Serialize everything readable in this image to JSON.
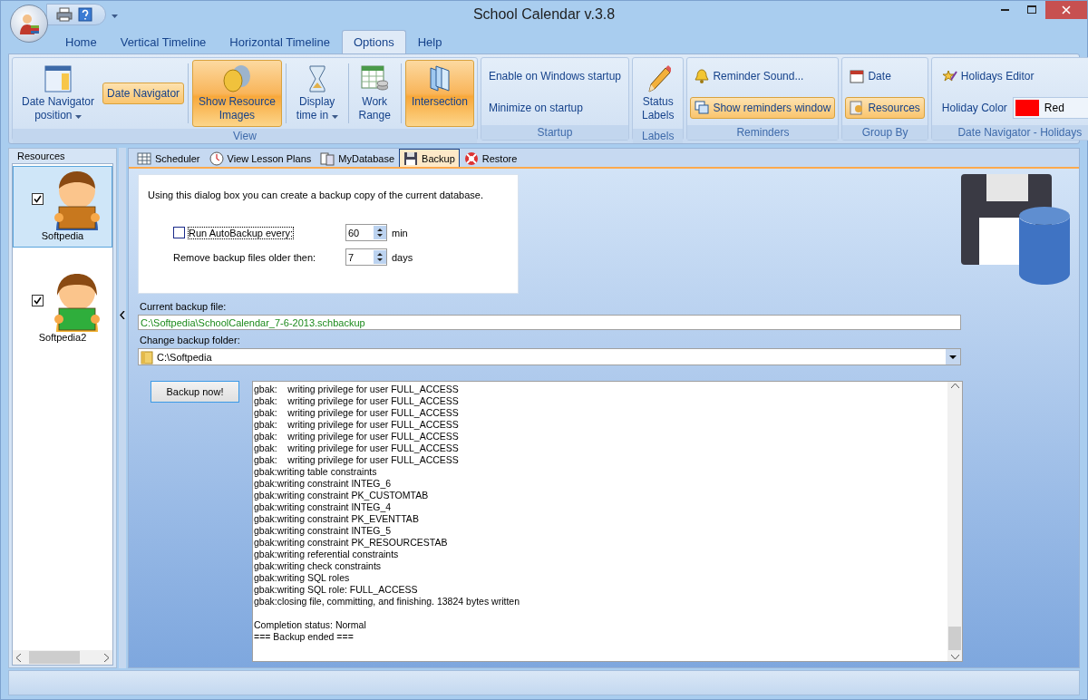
{
  "window": {
    "title": "School Calendar v.3.8"
  },
  "menu_tabs": [
    {
      "label": "Home",
      "selected": false
    },
    {
      "label": "Vertical Timeline",
      "selected": false
    },
    {
      "label": "Horizontal Timeline",
      "selected": false
    },
    {
      "label": "Options",
      "selected": true
    },
    {
      "label": "Help",
      "selected": false
    }
  ],
  "ribbon": {
    "groups": [
      {
        "label": "View",
        "items": [
          {
            "kind": "large",
            "lines": [
              "Date Navigator",
              "position"
            ],
            "dropdown": true,
            "selected": false
          },
          {
            "kind": "small",
            "label": "Date Navigator",
            "selected": true
          },
          {
            "kind": "large",
            "lines": [
              "Show Resource",
              "Images"
            ],
            "dropdown": false,
            "selected": true
          },
          {
            "kind": "large",
            "lines": [
              "Display",
              "time in"
            ],
            "dropdown": true,
            "selected": false
          },
          {
            "kind": "large",
            "lines": [
              "Work",
              "Range"
            ],
            "dropdown": false,
            "selected": false
          },
          {
            "kind": "large",
            "lines": [
              "Intersection"
            ],
            "dropdown": false,
            "selected": true
          }
        ]
      },
      {
        "label": "Startup",
        "items": [
          {
            "kind": "stack",
            "buttons": [
              {
                "label": "Enable on Windows startup",
                "selected": false
              },
              {
                "label": "Minimize on startup",
                "selected": false
              }
            ]
          }
        ]
      },
      {
        "label": "Labels",
        "items": [
          {
            "kind": "large",
            "lines": [
              "Status",
              "Labels"
            ],
            "dropdown": false,
            "selected": false
          }
        ]
      },
      {
        "label": "Reminders",
        "items": [
          {
            "kind": "stack",
            "buttons": [
              {
                "label": "Reminder Sound...",
                "selected": false
              },
              {
                "label": "Show reminders window",
                "selected": true
              }
            ]
          }
        ]
      },
      {
        "label": "Group By",
        "items": [
          {
            "kind": "stack",
            "buttons": [
              {
                "label": "Date",
                "selected": false
              },
              {
                "label": "Resources",
                "selected": true
              }
            ]
          }
        ]
      },
      {
        "label": "Date Navigator - Holidays",
        "items": [
          {
            "kind": "holidays",
            "editor": "Holidays Editor",
            "color_label": "Holiday Color",
            "color_value": "Red",
            "color": "#ff0000"
          }
        ]
      }
    ]
  },
  "resources": {
    "title": "Resources",
    "items": [
      {
        "name": "Softpedia",
        "checked": true,
        "selected": true,
        "color": "#c8781e"
      },
      {
        "name": "Softpedia2",
        "checked": true,
        "selected": false,
        "color": "#2fae3c"
      }
    ]
  },
  "content_tabs": [
    {
      "label": "Scheduler",
      "selected": false
    },
    {
      "label": "View Lesson Plans",
      "selected": false
    },
    {
      "label": "MyDatabase",
      "selected": false
    },
    {
      "label": "Backup",
      "selected": true
    },
    {
      "label": "Restore",
      "selected": false
    }
  ],
  "backup": {
    "intro": "Using this dialog box you can create a backup copy of the current database.",
    "autobackup": {
      "label": "Run AutoBackup every:",
      "checked": false,
      "value": "60",
      "unit": "min"
    },
    "remove": {
      "label": "Remove backup files older then:",
      "value": "7",
      "unit": "days"
    },
    "current_file_label": "Current backup file:",
    "current_file": "C:\\Softpedia\\SchoolCalendar_7-6-2013.schbackup",
    "folder_label": "Change backup folder:",
    "folder": "C:\\Softpedia",
    "button": "Backup now!",
    "log": [
      "gbak:    writing privilege for user FULL_ACCESS",
      "gbak:    writing privilege for user FULL_ACCESS",
      "gbak:    writing privilege for user FULL_ACCESS",
      "gbak:    writing privilege for user FULL_ACCESS",
      "gbak:    writing privilege for user FULL_ACCESS",
      "gbak:    writing privilege for user FULL_ACCESS",
      "gbak:    writing privilege for user FULL_ACCESS",
      "gbak:writing table constraints",
      "gbak:writing constraint INTEG_6",
      "gbak:writing constraint PK_CUSTOMTAB",
      "gbak:writing constraint INTEG_4",
      "gbak:writing constraint PK_EVENTTAB",
      "gbak:writing constraint INTEG_5",
      "gbak:writing constraint PK_RESOURCESTAB",
      "gbak:writing referential constraints",
      "gbak:writing check constraints",
      "gbak:writing SQL roles",
      "gbak:writing SQL role: FULL_ACCESS",
      "gbak:closing file, committing, and finishing. 13824 bytes written"
    ],
    "summary": [
      "Completion status: Normal",
      "=== Backup ended ==="
    ]
  }
}
